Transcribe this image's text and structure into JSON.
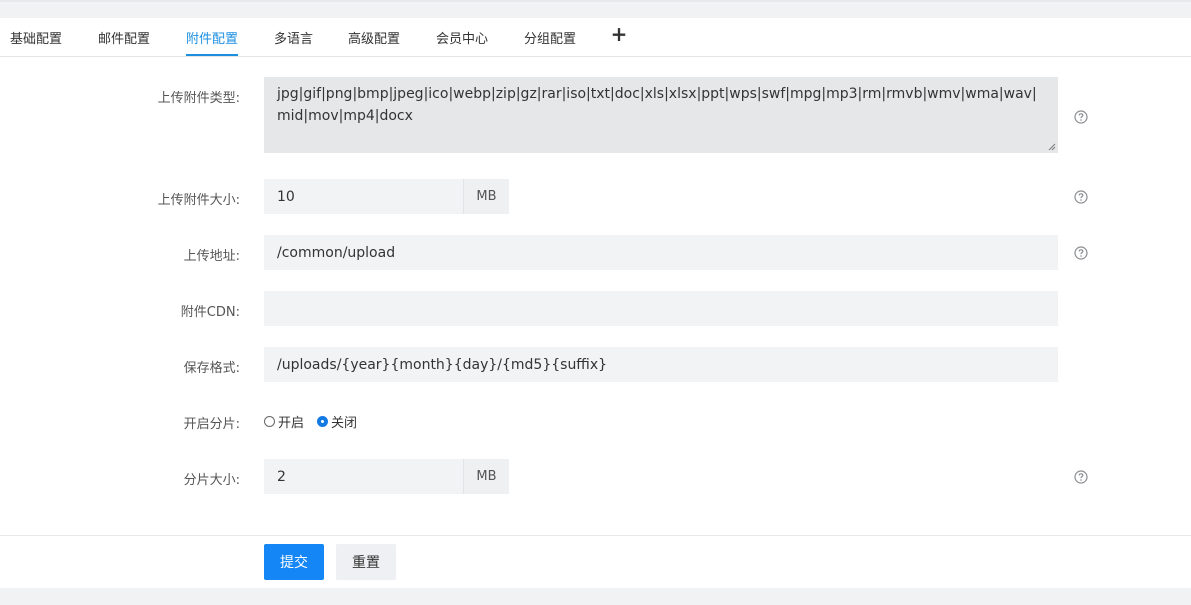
{
  "tabs": [
    {
      "label": "基础配置"
    },
    {
      "label": "邮件配置"
    },
    {
      "label": "附件配置",
      "active": true
    },
    {
      "label": "多语言"
    },
    {
      "label": "高级配置"
    },
    {
      "label": "会员中心"
    },
    {
      "label": "分组配置"
    }
  ],
  "tab_add": "+",
  "form": {
    "upload_types": {
      "label": "上传附件类型:",
      "value": "jpg|gif|png|bmp|jpeg|ico|webp|zip|gz|rar|iso|txt|doc|xls|xlsx|ppt|wps|swf|mpg|mp3|rm|rmvb|wmv|wma|wav|mid|mov|mp4|docx"
    },
    "upload_size": {
      "label": "上传附件大小:",
      "value": "10",
      "unit": "MB"
    },
    "upload_url": {
      "label": "上传地址:",
      "value": "/common/upload"
    },
    "cdn": {
      "label": "附件CDN:",
      "value": ""
    },
    "save_format": {
      "label": "保存格式:",
      "value": "/uploads/{year}{month}{day}/{md5}{suffix}"
    },
    "chunking": {
      "label": "开启分片:",
      "options": [
        {
          "label": "开启",
          "checked": false
        },
        {
          "label": "关闭",
          "checked": true
        }
      ]
    },
    "chunk_size": {
      "label": "分片大小:",
      "value": "2",
      "unit": "MB"
    }
  },
  "actions": {
    "submit": "提交",
    "reset": "重置"
  },
  "colors": {
    "accent": "#1d8fe0",
    "primary_button": "#1486f6"
  }
}
